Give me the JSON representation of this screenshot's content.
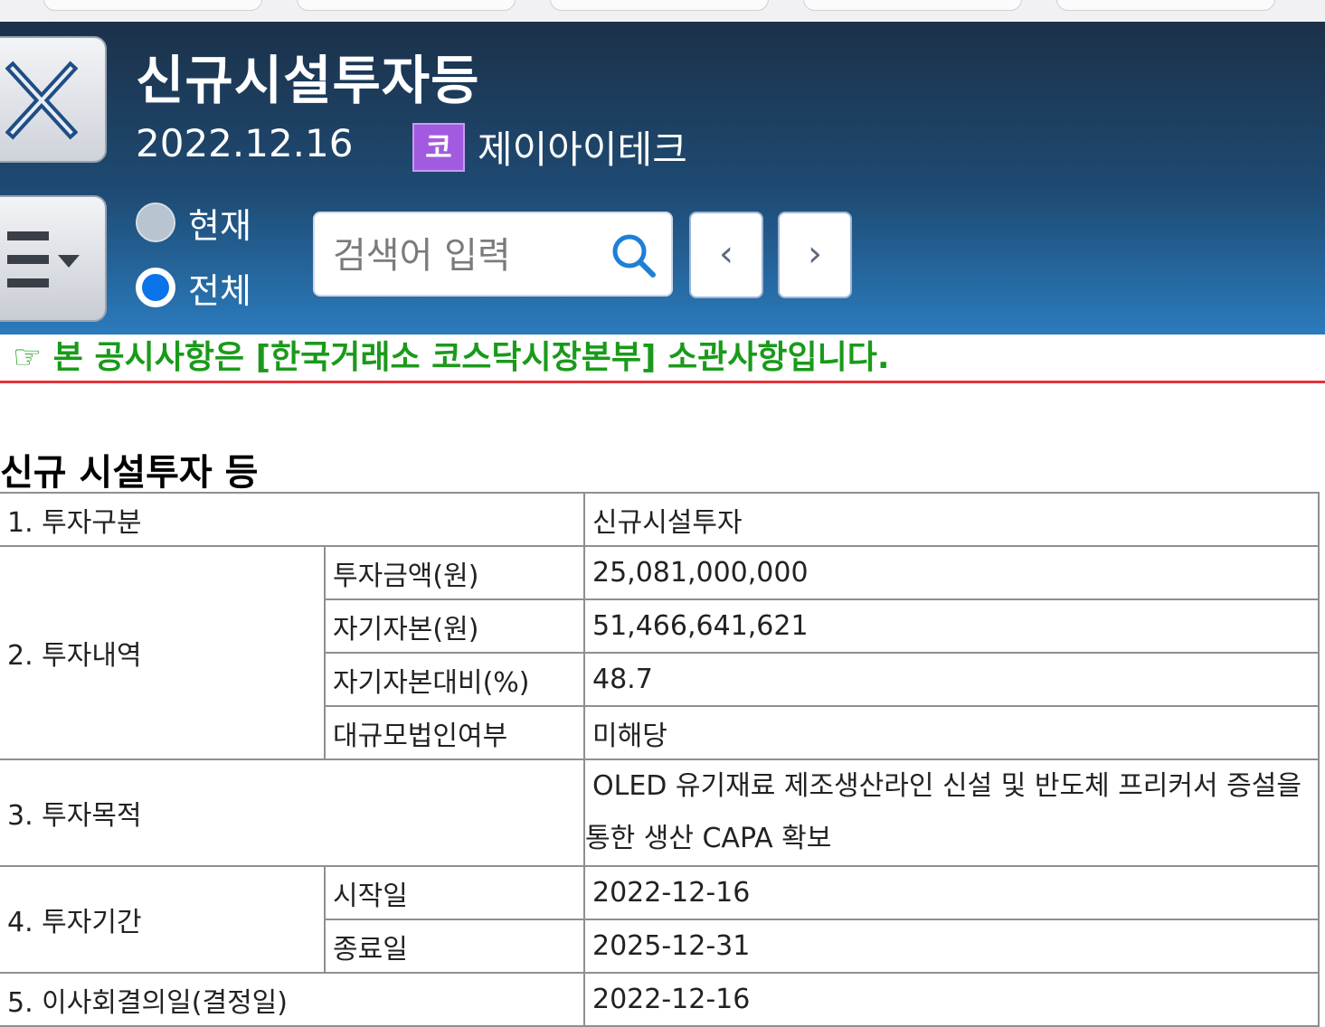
{
  "header": {
    "title": "신규시설투자등",
    "date": "2022.12.16",
    "market_badge": "코",
    "company": "제이아이테크"
  },
  "scope": {
    "current_label": "현재",
    "all_label": "전체",
    "selected": "전체"
  },
  "search": {
    "placeholder": "검색어 입력",
    "prev_label": "‹",
    "next_label": "›"
  },
  "notice": "☞ 본 공시사항은 [한국거래소 코스닥시장본부] 소관사항입니다.",
  "section_title": "신규 시설투자 등",
  "table": {
    "row1": {
      "label": "1. 투자구분",
      "value": "신규시설투자"
    },
    "row2": {
      "label": "2. 투자내역",
      "items": [
        {
          "label": "투자금액(원)",
          "value": "25,081,000,000"
        },
        {
          "label": "자기자본(원)",
          "value": "51,466,641,621"
        },
        {
          "label": "자기자본대비(%)",
          "value": "48.7"
        },
        {
          "label": "대규모법인여부",
          "value": "미해당"
        }
      ]
    },
    "row3": {
      "label": "3. 투자목적",
      "value": "OLED 유기재료 제조생산라인 신설 및 반도체 프리커서 증설을 통한 생산 CAPA 확보"
    },
    "row4": {
      "label": "4. 투자기간",
      "items": [
        {
          "label": "시작일",
          "value": "2022-12-16"
        },
        {
          "label": "종료일",
          "value": "2025-12-31"
        }
      ]
    },
    "row5": {
      "label": "5. 이사회결의일(결정일)",
      "value": "2022-12-16"
    }
  },
  "colors": {
    "header_top": "#1c3149",
    "header_bottom": "#2b7bbd",
    "notice_text": "#1a9a1a",
    "notice_rule": "#e5323b",
    "badge": "#a25be0",
    "radio_selected": "#0a74e8"
  }
}
